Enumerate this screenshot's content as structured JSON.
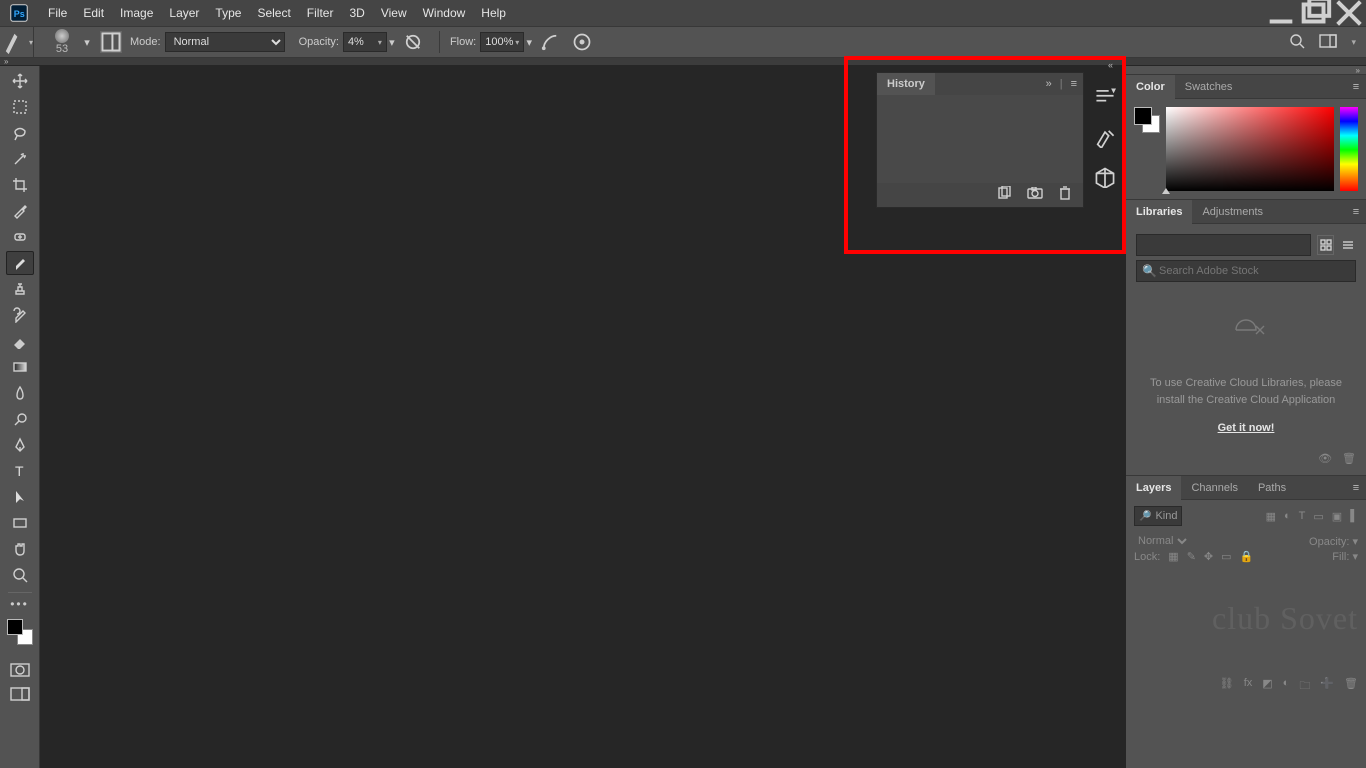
{
  "menubar": {
    "items": [
      "File",
      "Edit",
      "Image",
      "Layer",
      "Type",
      "Select",
      "Filter",
      "3D",
      "View",
      "Window",
      "Help"
    ]
  },
  "optionsbar": {
    "brush_size": "53",
    "mode_label": "Mode:",
    "mode_value": "Normal",
    "opacity_label": "Opacity:",
    "opacity_value": "4%",
    "flow_label": "Flow:",
    "flow_value": "100%"
  },
  "tools": {
    "names": [
      "move",
      "rect-marquee",
      "lasso",
      "magic-wand",
      "crop",
      "eyedropper",
      "spot-heal",
      "brush",
      "clone-stamp",
      "history-brush",
      "eraser",
      "gradient",
      "blur",
      "dodge",
      "pen",
      "type",
      "path-select",
      "rectangle",
      "hand",
      "zoom"
    ],
    "active": "brush"
  },
  "panels": {
    "color": {
      "tabs": [
        "Color",
        "Swatches"
      ]
    },
    "libraries": {
      "tabs": [
        "Libraries",
        "Adjustments"
      ],
      "search_placeholder": "Search Adobe Stock",
      "message": "To use Creative Cloud Libraries, please install the Creative Cloud Application",
      "link": "Get it now!"
    },
    "layers": {
      "tabs": [
        "Layers",
        "Channels",
        "Paths"
      ],
      "kind_label": "Kind",
      "blend_mode": "Normal",
      "opacity_label": "Opacity:",
      "lock_label": "Lock:",
      "fill_label": "Fill:",
      "watermark": "club Sovet"
    },
    "history": {
      "title": "History"
    }
  }
}
